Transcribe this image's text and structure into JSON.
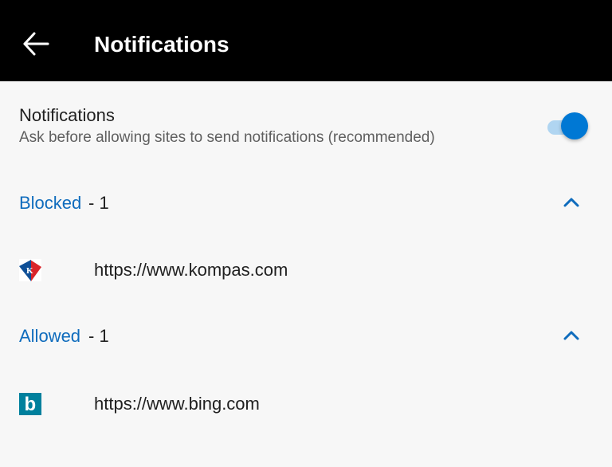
{
  "app_bar": {
    "back_icon": "arrow-left-icon",
    "title": "Notifications"
  },
  "setting": {
    "title": "Notifications",
    "description": "Ask before allowing sites to send notifications (recommended)",
    "toggle_on": true
  },
  "sections": {
    "blocked": {
      "label": "Blocked",
      "count": "- 1",
      "collapse_icon": "chevron-up-icon",
      "sites": [
        {
          "url": "https://www.kompas.com",
          "icon": "kompas-favicon",
          "icon_letter": "K"
        }
      ]
    },
    "allowed": {
      "label": "Allowed",
      "count": "- 1",
      "collapse_icon": "chevron-up-icon",
      "sites": [
        {
          "url": "https://www.bing.com",
          "icon": "bing-favicon",
          "icon_letter": "b"
        }
      ]
    }
  },
  "colors": {
    "app_bar_bg": "#000000",
    "app_bar_text": "#ffffff",
    "page_bg": "#f7f7f7",
    "primary_text": "#202020",
    "secondary_text": "#5f5f5f",
    "accent": "#0078d4",
    "section_label": "#0f6cbd",
    "toggle_track": "#76b9ed",
    "kompas_blue": "#0e4f97",
    "kompas_red": "#d71920",
    "bing_teal": "#00809d"
  }
}
